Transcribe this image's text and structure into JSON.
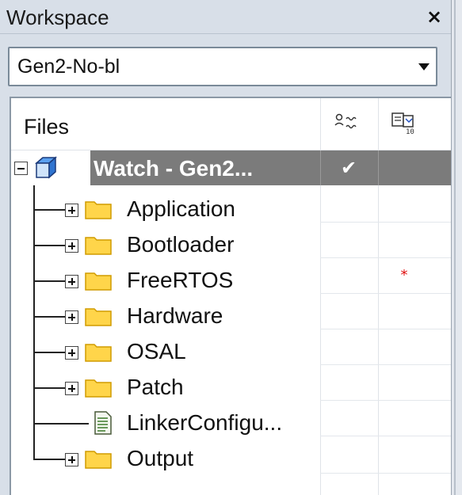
{
  "window": {
    "title": "Workspace",
    "close_label": "×"
  },
  "config_selector": {
    "selected": "Gen2-No-bl"
  },
  "tree_header": {
    "files_label": "Files",
    "col1_icon": "build-status-icon",
    "col2_icon": "options-icon"
  },
  "tree": {
    "root": {
      "label": "Watch - Gen2...",
      "icon": "project-cube-icon",
      "checked_mark": "✔"
    },
    "items": [
      {
        "label": "Application",
        "type": "folder",
        "icon": "folder-icon"
      },
      {
        "label": "Bootloader",
        "type": "folder",
        "icon": "folder-icon"
      },
      {
        "label": "FreeRTOS",
        "type": "folder",
        "icon": "folder-icon",
        "marker": "*"
      },
      {
        "label": "Hardware",
        "type": "folder",
        "icon": "folder-icon"
      },
      {
        "label": "OSAL",
        "type": "folder",
        "icon": "folder-icon"
      },
      {
        "label": "Patch",
        "type": "folder",
        "icon": "folder-icon"
      },
      {
        "label": "LinkerConfigu...",
        "type": "file",
        "icon": "document-icon"
      },
      {
        "label": "Output",
        "type": "folder",
        "icon": "folder-icon"
      }
    ]
  },
  "colors": {
    "panel_bg": "#d8dfe8",
    "selection_bg": "#7b7b7b",
    "folder_fill": "#ffd54a",
    "marker": "#e01010"
  }
}
